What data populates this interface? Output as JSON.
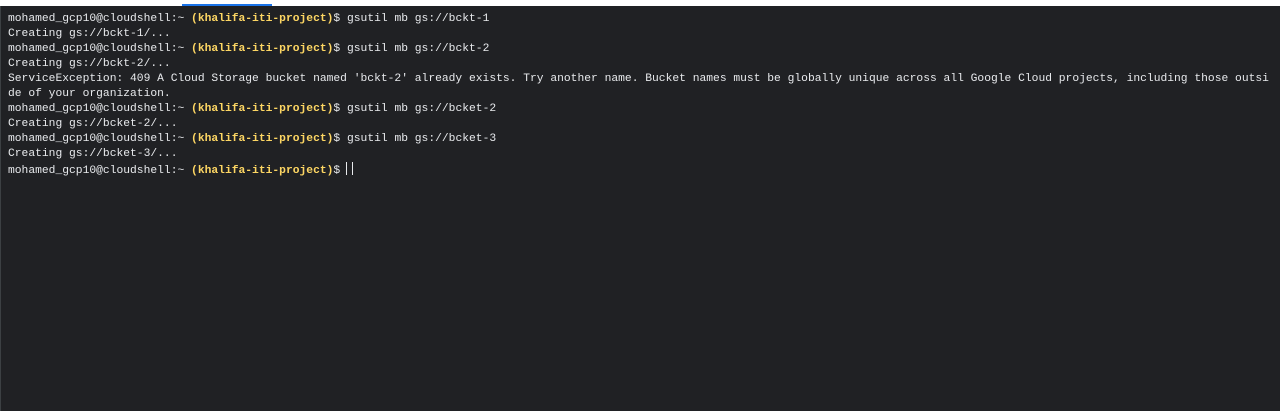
{
  "terminal": {
    "prompt": {
      "user_host": "mohamed_gcp10@cloudshell:~",
      "project": "(khalifa-iti-project)",
      "symbol": "$"
    },
    "lines": [
      {
        "type": "command",
        "command": "gsutil mb gs://bckt-1"
      },
      {
        "type": "output",
        "text": "Creating gs://bckt-1/..."
      },
      {
        "type": "command",
        "command": "gsutil mb gs://bckt-2"
      },
      {
        "type": "output",
        "text": "Creating gs://bckt-2/..."
      },
      {
        "type": "error",
        "text": "ServiceException: 409 A Cloud Storage bucket named 'bckt-2' already exists. Try another name. Bucket names must be globally unique across all Google Cloud projects, including those outside of your organization."
      },
      {
        "type": "command",
        "command": "gsutil mb gs://bcket-2"
      },
      {
        "type": "output",
        "text": "Creating gs://bcket-2/..."
      },
      {
        "type": "command",
        "command": "gsutil mb gs://bcket-3"
      },
      {
        "type": "output",
        "text": "Creating gs://bcket-3/..."
      },
      {
        "type": "prompt",
        "command": ""
      }
    ]
  }
}
